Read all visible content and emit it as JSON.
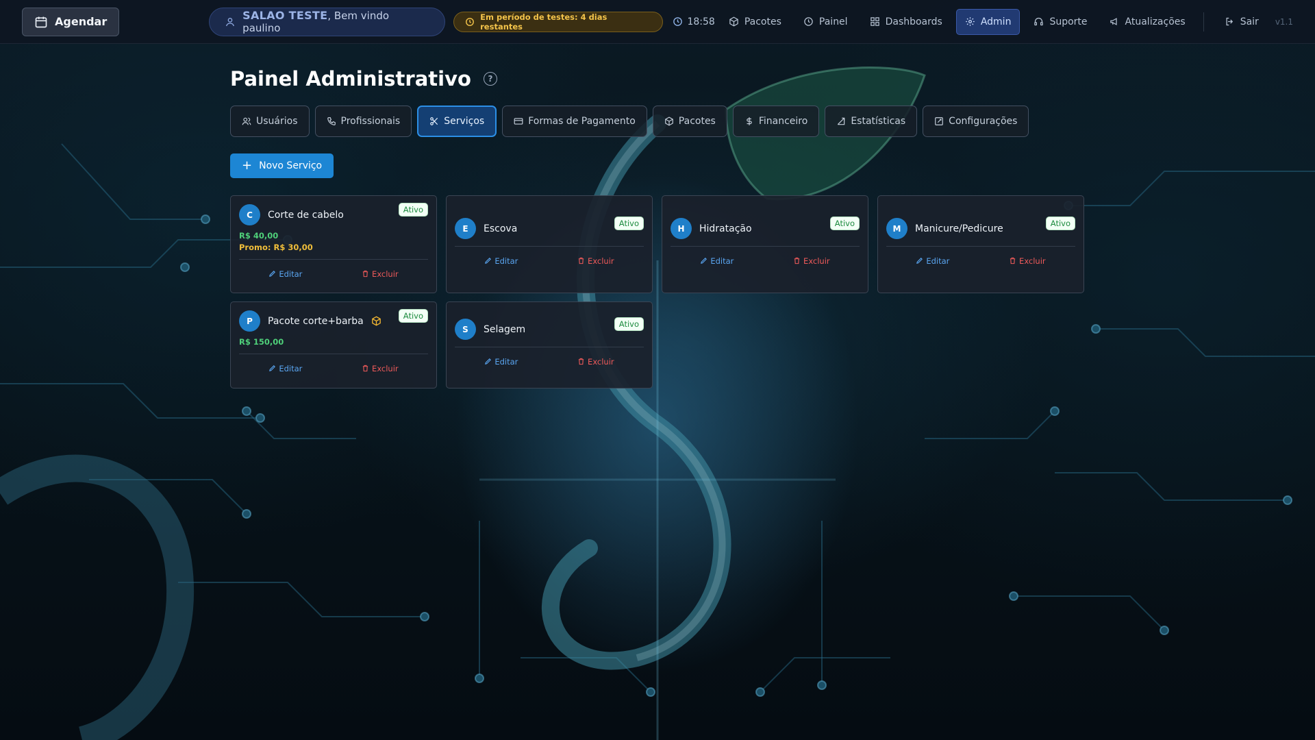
{
  "header": {
    "agendar_label": "Agendar",
    "salon_name": "SALAO TESTE",
    "welcome_text": ", Bem vindo paulino",
    "trial_text": "Em período de testes: 4 dias restantes",
    "time": "18:58",
    "nav": [
      {
        "label": "Pacotes",
        "icon": "package-icon"
      },
      {
        "label": "Painel",
        "icon": "clock-icon"
      },
      {
        "label": "Dashboards",
        "icon": "grid-icon"
      },
      {
        "label": "Admin",
        "icon": "gear-icon",
        "active": true
      },
      {
        "label": "Suporte",
        "icon": "headset-icon"
      },
      {
        "label": "Atualizações",
        "icon": "megaphone-icon"
      }
    ],
    "logout_label": "Sair",
    "version": "v1.1"
  },
  "page": {
    "title": "Painel Administrativo",
    "help_symbol": "?",
    "tabs": [
      {
        "label": "Usuários",
        "icon": "users-icon"
      },
      {
        "label": "Profissionais",
        "icon": "phone-icon"
      },
      {
        "label": "Serviços",
        "icon": "scissors-icon",
        "active": true
      },
      {
        "label": "Formas de Pagamento",
        "icon": "credit-card-icon"
      },
      {
        "label": "Pacotes",
        "icon": "package-icon"
      },
      {
        "label": "Financeiro",
        "icon": "dollar-icon"
      },
      {
        "label": "Estatísticas",
        "icon": "edit-icon"
      },
      {
        "label": "Configurações",
        "icon": "edit-icon"
      }
    ],
    "new_service_label": "Novo Serviço"
  },
  "services": [
    {
      "initial": "C",
      "name": "Corte de cabelo",
      "status": "Ativo",
      "price": "R$ 40,00",
      "promo": "Promo: R$ 30,00"
    },
    {
      "initial": "E",
      "name": "Escova",
      "status": "Ativo"
    },
    {
      "initial": "H",
      "name": "Hidratação",
      "status": "Ativo"
    },
    {
      "initial": "M",
      "name": "Manicure/Pedicure",
      "status": "Ativo"
    },
    {
      "initial": "P",
      "name": "Pacote corte+barba",
      "status": "Ativo",
      "price": "R$ 150,00",
      "is_package": true
    },
    {
      "initial": "S",
      "name": "Selagem",
      "status": "Ativo"
    }
  ],
  "card_actions": {
    "edit": "Editar",
    "delete": "Excluir"
  },
  "colors": {
    "accent": "#1d86d4",
    "active_tab_border": "#2c8fe6",
    "price": "#4fd07a",
    "promo": "#f0be3a",
    "delete": "#ef5a5a",
    "trial": "#f3c34a"
  }
}
